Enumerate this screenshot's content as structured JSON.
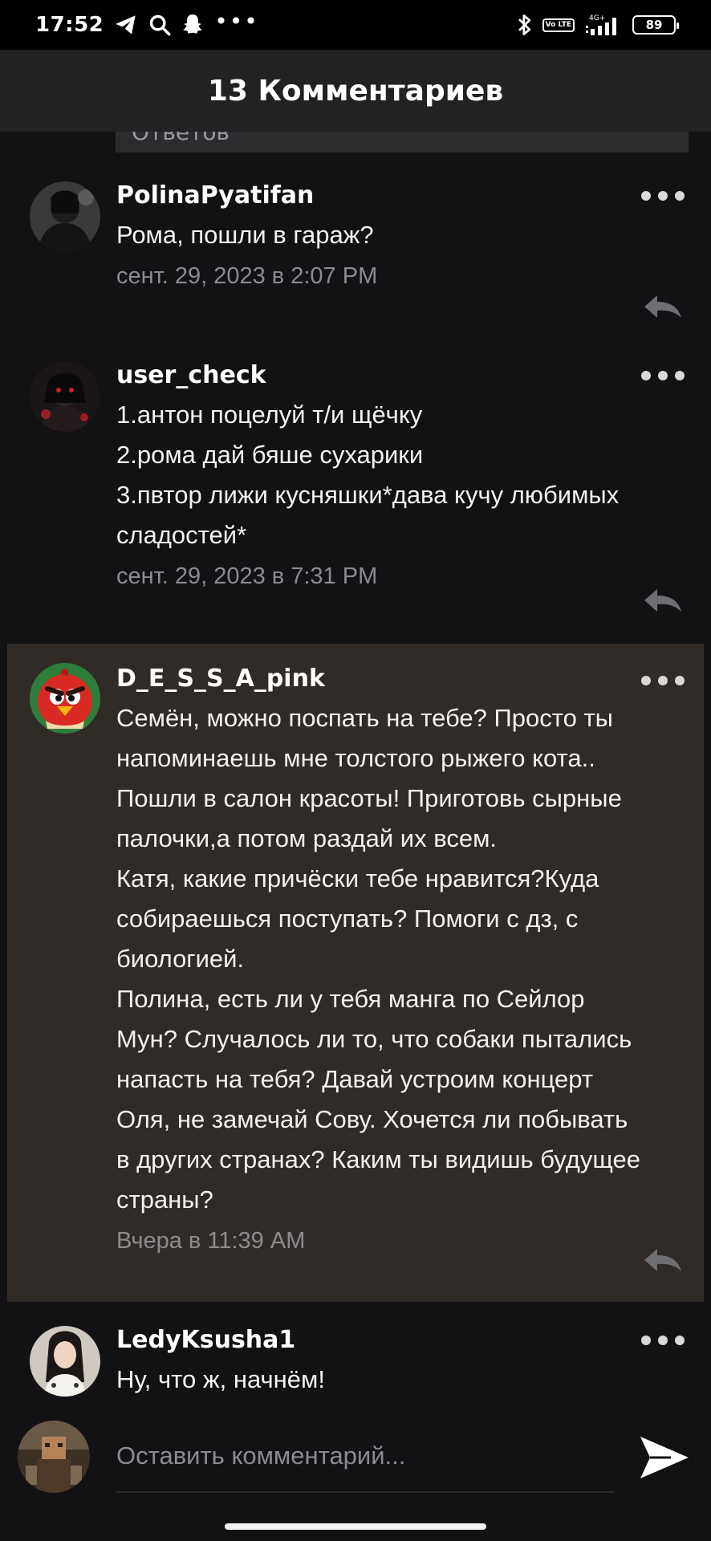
{
  "status_bar": {
    "time": "17:52",
    "battery": "89",
    "network": "4G+",
    "volte": "Vo LTE"
  },
  "header": {
    "title": "13 Комментариев"
  },
  "peek": {
    "text": "Ответов"
  },
  "comments": [
    {
      "user": "PolinaPyatifan",
      "text": "Рома, пошли в гараж?",
      "date": "сент. 29, 2023 в 2:07 PM"
    },
    {
      "user": "user_check",
      "text": "1.антон поцелуй т/и щёчку\n2.рома дай бяше сухарики\n3.пвтор лижи кусняшки*дава кучу любимых\nсладостей*",
      "date": "сент. 29, 2023 в 7:31 PM"
    },
    {
      "user": "D_E_S_S_A_pink",
      "text": "Семён, можно поспать на тебе? Просто ты\nнапоминаешь мне толстого рыжего кота..\nПошли в салон красоты! Приготовь сырные\nпалочки,а потом раздай их всем.\nКатя, какие причёски тебе нравится?Куда\nсобираешься поступать? Помоги с дз, с\nбиологией.\nПолина, есть ли у тебя манга по Сейлор\nМун? Случалось ли то, что собаки пытались\nнапасть на тебя? Давай устроим концерт\nОля, не замечай Сову. Хочется ли побывать\nв других странах? Каким ты видишь будущее\nстраны?",
      "date": "Вчера в 11:39 AM",
      "highlighted": true
    },
    {
      "user": "LedyKsusha1",
      "text": "Ну, что ж, начнём!",
      "date": ""
    }
  ],
  "composer": {
    "placeholder": "Оставить комментарий..."
  },
  "colors": {
    "background": "#121114",
    "header": "#222124",
    "highlight": "#302b27",
    "muted_text": "#8c8c90"
  },
  "icons": [
    "telegram-icon",
    "search-icon",
    "snapchat-icon",
    "bluetooth-icon",
    "signal-icon",
    "battery-icon",
    "more-icon",
    "reply-icon",
    "send-icon"
  ]
}
